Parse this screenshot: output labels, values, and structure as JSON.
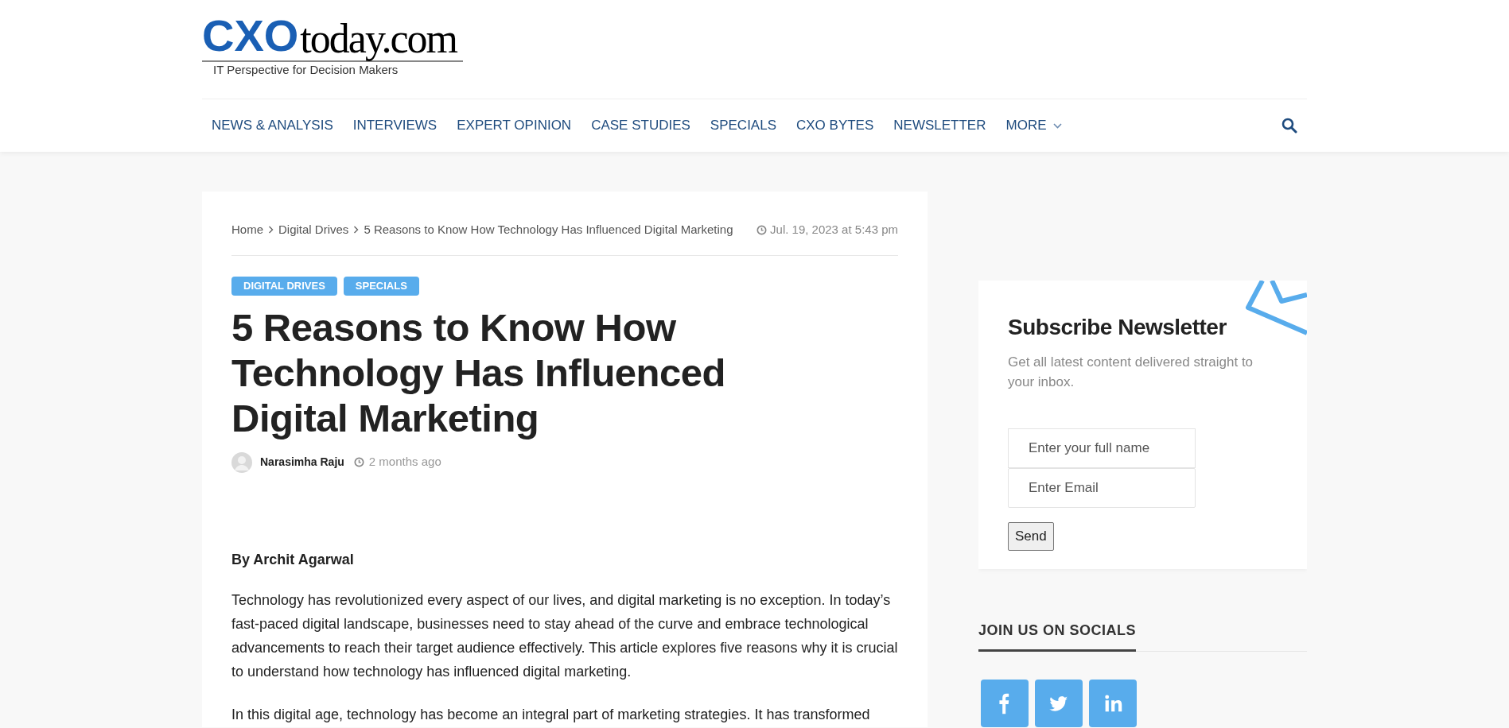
{
  "logo": {
    "brand": "CXO",
    "domain": "today.com",
    "tagline": "IT Perspective for Decision Makers"
  },
  "nav": {
    "items": [
      {
        "label": "NEWS & ANALYSIS",
        "has_menu": false
      },
      {
        "label": "INTERVIEWS",
        "has_menu": false
      },
      {
        "label": "EXPERT OPINION",
        "has_menu": false
      },
      {
        "label": "CASE STUDIES",
        "has_menu": false
      },
      {
        "label": "SPECIALS",
        "has_menu": false
      },
      {
        "label": "CXO BYTES",
        "has_menu": false
      },
      {
        "label": "NEWSLETTER",
        "has_menu": false
      },
      {
        "label": "MORE",
        "has_menu": true
      }
    ]
  },
  "breadcrumb": [
    "Home",
    "Digital Drives",
    "5 Reasons to Know How Technology Has Influenced Digital Marketing"
  ],
  "date": "Jul. 19, 2023 at 5:43 pm",
  "tags": [
    "DIGITAL DRIVES",
    "SPECIALS"
  ],
  "title": "5 Reasons to Know How Technology Has Influenced Digital Marketing",
  "author": {
    "name": "Narasimha Raju",
    "time": "2 months ago"
  },
  "byline": "By Archit Agarwal",
  "paragraphs": [
    "Technology has revolutionized every aspect of our lives, and digital marketing is no exception. In today’s fast-paced digital landscape, businesses need to stay ahead of the curve and embrace technological advancements to reach their target audience effectively. This article explores five reasons why it is crucial to understand how technology has influenced digital marketing.",
    "In this digital age, technology has become an integral part of marketing strategies. It has transformed"
  ],
  "newsletter": {
    "title": "Subscribe Newsletter",
    "description": "Get all latest content delivered straight to your inbox.",
    "fields": [
      {
        "placeholder": "Enter your full name"
      },
      {
        "placeholder": "Enter Email"
      }
    ],
    "button": "Send"
  },
  "socials": {
    "title": "JOIN US ON SOCIALS",
    "links": [
      {
        "kind": "facebook"
      },
      {
        "kind": "twitter"
      },
      {
        "kind": "linkedin"
      }
    ]
  }
}
